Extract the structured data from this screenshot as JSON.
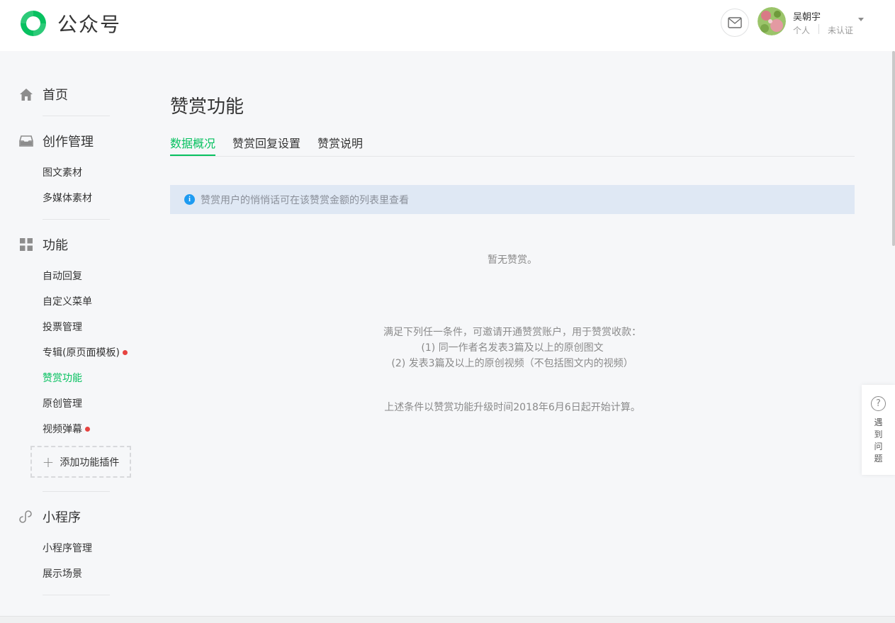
{
  "header": {
    "logo_text": "公众号",
    "user_name": "吴朝宇",
    "user_type": "个人",
    "user_verify": "未认证"
  },
  "sidebar": {
    "home": "首页",
    "creation": {
      "title": "创作管理",
      "items": [
        "图文素材",
        "多媒体素材"
      ]
    },
    "functions": {
      "title": "功能",
      "items": [
        "自动回复",
        "自定义菜单",
        "投票管理",
        "专辑(原页面模板)",
        "赞赏功能",
        "原创管理",
        "视频弹幕"
      ],
      "add_plugin": "添加功能插件"
    },
    "miniprogram": {
      "title": "小程序",
      "items": [
        "小程序管理",
        "展示场景"
      ]
    }
  },
  "main": {
    "title": "赞赏功能",
    "tabs": [
      "数据概况",
      "赞赏回复设置",
      "赞赏说明"
    ],
    "notice": "赞赏用户的悄悄话可在该赞赏金额的列表里查看",
    "empty_text": "暂无赞赏。",
    "conditions": [
      "满足下列任一条件，可邀请开通赞赏账户，用于赞赏收款：",
      "(1) 同一作者名发表3篇及以上的原创图文",
      "(2) 发表3篇及以上的原创视频（不包括图文内的视频）"
    ],
    "footnote": "上述条件以赞赏功能升级时间2018年6月6日起开始计算。"
  },
  "help": {
    "label": "遇到问题"
  },
  "colors": {
    "accent": "#07c160",
    "badge": "#e64340",
    "notice_bg": "#dfe8f4",
    "info": "#1e9bf1"
  }
}
